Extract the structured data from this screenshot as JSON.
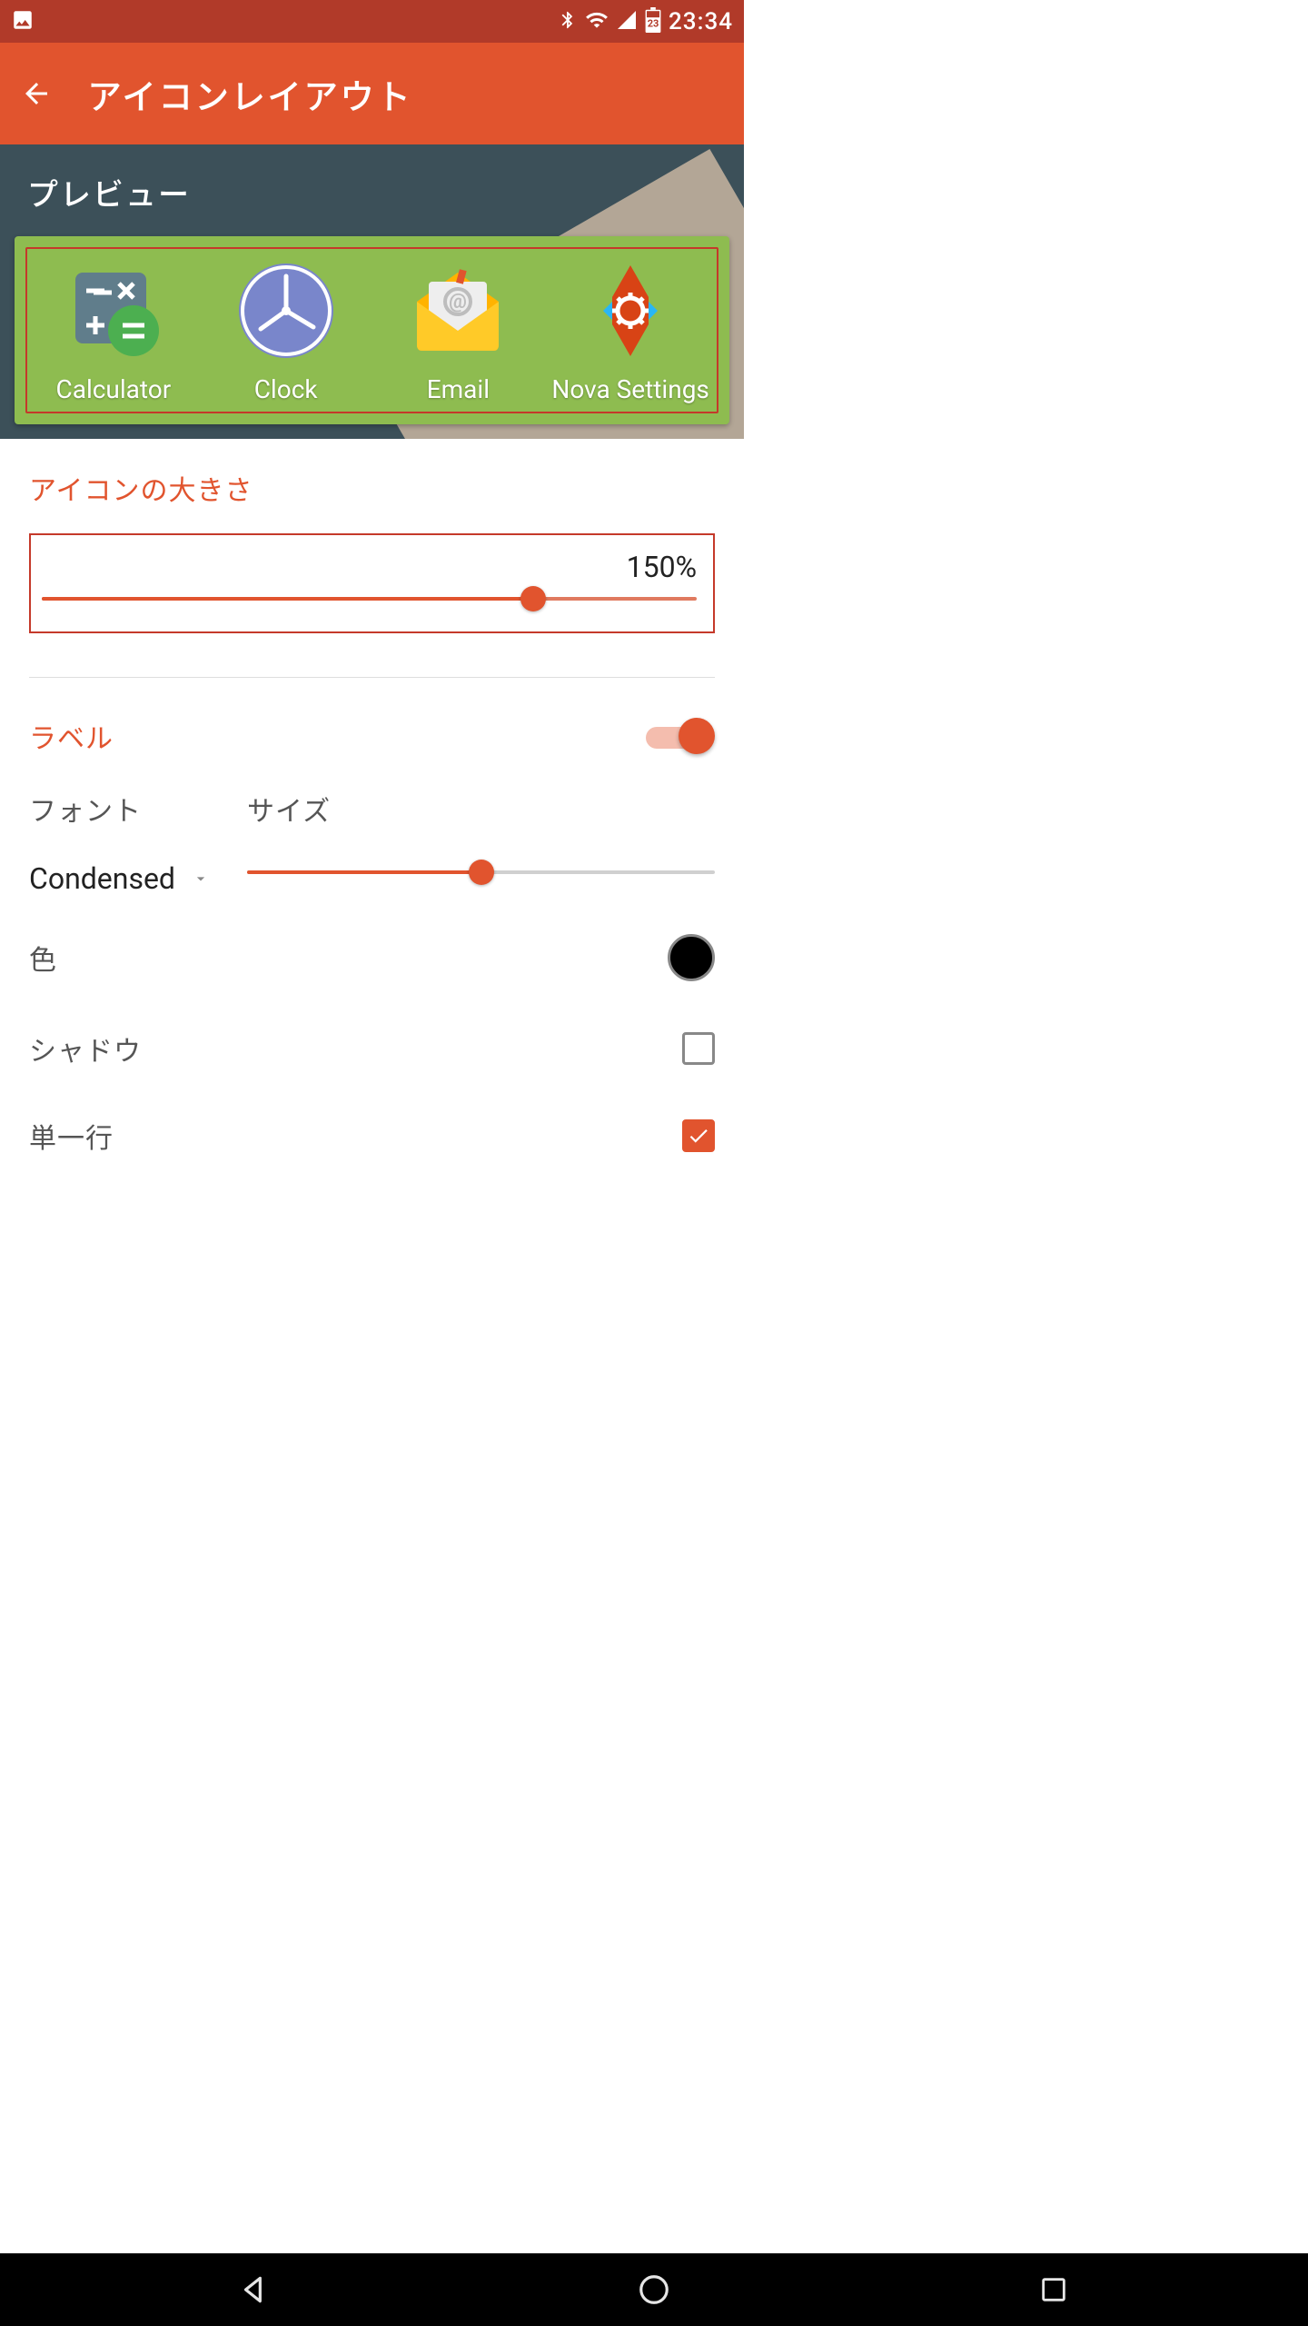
{
  "status": {
    "time": "23:34",
    "battery_day": "23"
  },
  "header": {
    "title": "アイコンレイアウト"
  },
  "preview": {
    "label": "プレビュー",
    "apps": [
      {
        "name": "Calculator"
      },
      {
        "name": "Clock"
      },
      {
        "name": "Email"
      },
      {
        "name": "Nova Settings"
      }
    ]
  },
  "iconSize": {
    "title": "アイコンの大きさ",
    "value_label": "150%",
    "value_percent": 75
  },
  "labelSection": {
    "title": "ラベル",
    "enabled": true,
    "font_label": "フォント",
    "font_value": "Condensed",
    "size_label": "サイズ",
    "size_percent": 50,
    "color_label": "色",
    "color_value": "#000000",
    "shadow_label": "シャドウ",
    "shadow_checked": false,
    "single_line_label": "単一行",
    "single_line_checked": true
  }
}
